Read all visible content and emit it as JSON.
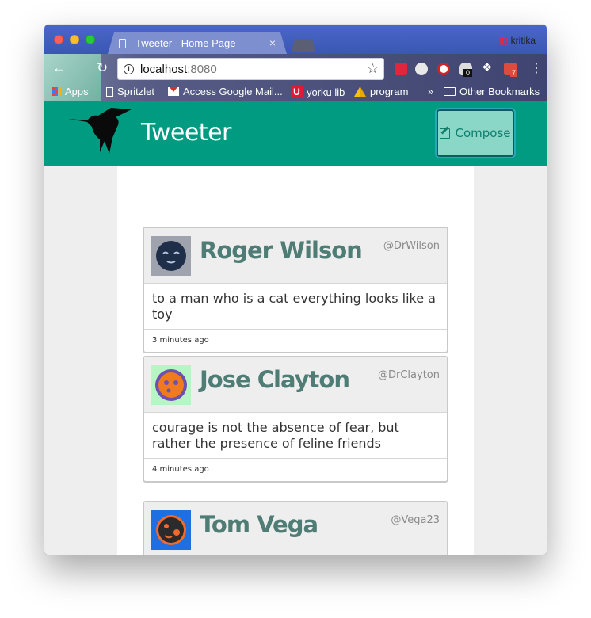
{
  "browser": {
    "tab_title": "Tweeter - Home Page",
    "tab_close": "×",
    "profile_name": "kritika",
    "url_host": "localhost",
    "url_port": ":8080",
    "nav_back": "←",
    "nav_reload": "↻",
    "star": "☆",
    "menu": "⋮",
    "ext_badge_count": "0",
    "ext_badge_todoist": "7"
  },
  "bookmarks": {
    "apps": "Apps",
    "spritzlet": "Spritzlet",
    "gmail": "Access Google Mail...",
    "york_glyph": "U",
    "york": "yorku lib",
    "program": "program",
    "more": "»",
    "other": "Other Bookmarks"
  },
  "header": {
    "title": "Tweeter",
    "compose_label": "Compose"
  },
  "tweets": [
    {
      "name": "Roger Wilson",
      "handle": "@DrWilson",
      "text": "to a man who is a cat everything looks like a toy",
      "time": "3 minutes ago",
      "avatar_icon": "sleepy-face-avatar",
      "avatar_bg": "#9fa3ad",
      "avatar_fg": "#1f2f4a"
    },
    {
      "name": "Jose Clayton",
      "handle": "@DrClayton",
      "text": "courage is not the absence of fear, but rather the presence of feline friends",
      "time": "4 minutes ago",
      "avatar_icon": "orange-face-avatar",
      "avatar_bg": "#b8f5c4",
      "avatar_fg": "#f07a1e"
    },
    {
      "name": "Tom Vega",
      "handle": "@Vega23",
      "text": "",
      "time": "",
      "avatar_icon": "dark-face-avatar",
      "avatar_bg": "#1e6fe0",
      "avatar_fg": "#2b2b2b"
    }
  ],
  "colors": {
    "header_bg": "#009b80",
    "compose_bg": "#8ad6c7",
    "name_color": "#4f7d76"
  }
}
